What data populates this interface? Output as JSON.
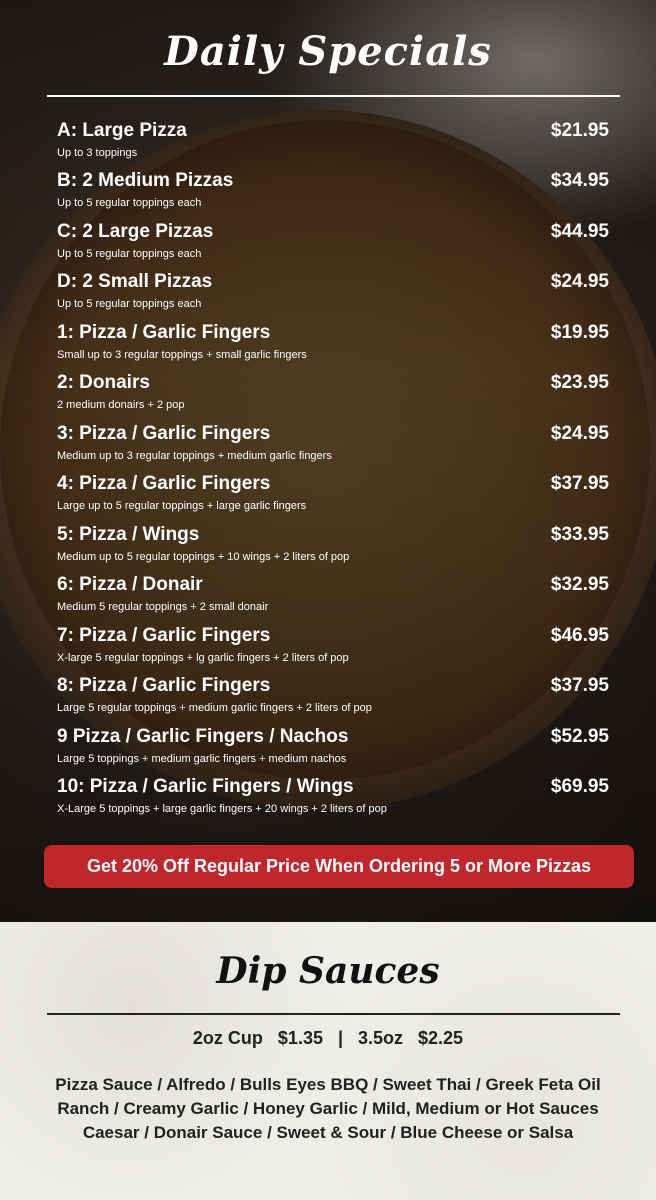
{
  "header": {
    "title": "Daily Specials"
  },
  "specials": [
    {
      "name": "A: Large Pizza",
      "desc": "Up to 3 toppings",
      "price": "$21.95"
    },
    {
      "name": "B: 2 Medium Pizzas",
      "desc": "Up to 5 regular toppings each",
      "price": "$34.95"
    },
    {
      "name": "C: 2 Large Pizzas",
      "desc": "Up to 5 regular toppings each",
      "price": "$44.95"
    },
    {
      "name": "D: 2 Small Pizzas",
      "desc": "Up to 5 regular toppings each",
      "price": "$24.95"
    },
    {
      "name": "1: Pizza / Garlic Fingers",
      "desc": "Small up to 3 regular toppings + small garlic fingers",
      "price": "$19.95"
    },
    {
      "name": "2: Donairs",
      "desc": "2 medium donairs + 2 pop",
      "price": "$23.95"
    },
    {
      "name": "3: Pizza / Garlic Fingers",
      "desc": "Medium up to 3 regular toppings + medium garlic fingers",
      "price": "$24.95"
    },
    {
      "name": "4: Pizza / Garlic Fingers",
      "desc": "Large up to 5 regular toppings + large garlic fingers",
      "price": "$37.95"
    },
    {
      "name": "5: Pizza / Wings",
      "desc": "Medium up to 5 regular toppings + 10 wings + 2 liters of pop",
      "price": "$33.95"
    },
    {
      "name": "6: Pizza / Donair",
      "desc": "Medium 5 regular toppings + 2 small donair",
      "price": "$32.95"
    },
    {
      "name": "7: Pizza / Garlic Fingers",
      "desc": "X-large 5 regular toppings + lg garlic fingers + 2 liters of pop",
      "price": "$46.95"
    },
    {
      "name": "8: Pizza / Garlic Fingers",
      "desc": "Large 5 regular toppings + medium garlic fingers + 2 liters of pop",
      "price": "$37.95"
    },
    {
      "name": "9 Pizza / Garlic Fingers / Nachos",
      "desc": "Large 5 toppings + medium garlic fingers + medium nachos",
      "price": "$52.95"
    },
    {
      "name": "10: Pizza / Garlic Fingers / Wings",
      "desc": "X-Large 5 toppings + large garlic fingers + 20 wings + 2 liters of pop",
      "price": "$69.95"
    }
  ],
  "promo": {
    "label": "Get 20% Off Regular Price When Ordering 5 or More Pizzas",
    "color": "#c0272d"
  },
  "dips": {
    "title": "Dip Sauces",
    "cups": "2oz Cup   $1.35   |   3.5oz   $2.25",
    "lines": [
      "Pizza Sauce / Alfredo / Bulls Eyes BBQ / Sweet Thai / Greek Feta Oil",
      "Ranch / Creamy Garlic / Honey Garlic / Mild, Medium or Hot Sauces",
      "Caesar / Donair Sauce / Sweet & Sour / Blue Cheese or Salsa"
    ]
  }
}
